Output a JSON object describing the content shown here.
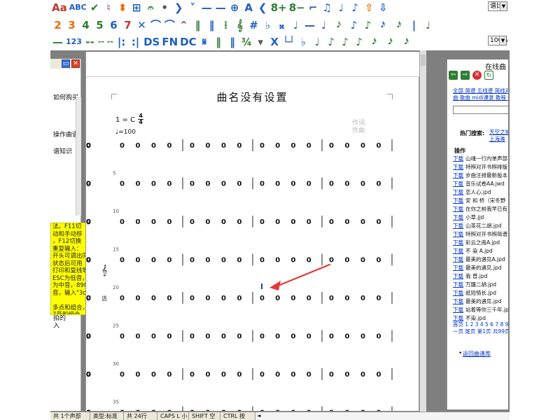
{
  "toolbar": {
    "row1": [
      "Aa",
      "ABC",
      "✔",
      "♮",
      "⬍",
      "⊞",
      "𝄐",
      "•",
      "❯",
      "˅",
      "—",
      "—",
      "⊕",
      "A",
      "❮",
      "8+",
      "8−",
      "⌐",
      "♫",
      "♩",
      "♪",
      "⇧",
      "⇩"
    ],
    "row1_combo": "谱比",
    "row2": [
      "2",
      "3",
      "4",
      "5",
      "6",
      "7",
      "✕",
      "⌒",
      "⌒",
      "⌃",
      "‖",
      "‖",
      "⁞",
      "𝄞",
      "#",
      "♭",
      "𝄪",
      "♩",
      "—",
      "♩",
      "𝅘𝅥𝅮",
      "♪",
      "♪",
      "𝅘𝅥𝅯",
      "𝅘𝅥𝅯",
      "|",
      "♩"
    ],
    "row3": [
      "—",
      "123",
      "--",
      "-- --",
      "|:",
      ":|",
      "DS",
      "FN",
      "DC",
      "𝄋",
      "‖",
      "‖",
      "¾",
      "▾",
      "X",
      "└┘",
      "♭",
      "♩",
      "♪",
      "♪",
      "♪",
      "𝅘𝅥𝅯",
      "𝅘𝅥𝅯",
      "𝅘𝅥𝅯"
    ],
    "zoom": "100%"
  },
  "left_panel": {
    "line1": "如何购买",
    "line2": "操作曲谱",
    "line3": "谱知识",
    "note_lines": [
      "法。F11切",
      "动和手动移",
      "，F12切换",
      "重复输入：",
      "开头可调出同",
      "状态后可用",
      "打印和复线等",
      "ESC为低音，",
      "为中音，890",
      "音，输入\"3o，]",
      "",
      "多点和组合，",
      "7音和组合，",
      "1.5拍组合。"
    ],
    "bottom_lines": [
      "拍的",
      "入"
    ]
  },
  "score": {
    "title": "曲名没有设置",
    "key": "1 = C",
    "time_num": "4",
    "time_den": "4",
    "tempo": "♩=100",
    "lyricist": "作词:",
    "composer": "作曲:",
    "clef_side": "𝄞",
    "row_side_label": "选",
    "rows": [
      {
        "line": "1",
        "measure": "",
        "notes": [
          "0",
          "0",
          "0",
          "0",
          "0",
          "0",
          "0",
          "0",
          "0",
          "0",
          "0",
          "0",
          "0",
          "0",
          "0",
          "0",
          "0",
          "0",
          "0",
          "0"
        ]
      },
      {
        "line": "2",
        "measure": "5",
        "notes": [
          "0",
          "0",
          "0",
          "0",
          "0",
          "0",
          "0",
          "0",
          "0",
          "0",
          "0",
          "0",
          "0",
          "0",
          "0",
          "0",
          "0",
          "0",
          "0",
          "0"
        ]
      },
      {
        "line": "3",
        "measure": "10",
        "notes": [
          "0",
          "0",
          "0",
          "0",
          "0",
          "0",
          "0",
          "0",
          "0",
          "0",
          "0",
          "0",
          "0",
          "0",
          "0",
          "0",
          "0",
          "0",
          "0",
          "0"
        ]
      },
      {
        "line": "4",
        "measure": "15",
        "notes": [
          "0",
          "0",
          "0",
          "0",
          "0",
          "0",
          "0",
          "0",
          "0",
          "0",
          "0",
          "0",
          "0",
          "0",
          "0",
          "0",
          "0",
          "0",
          "0",
          "0"
        ]
      },
      {
        "line": "5",
        "measure": "20",
        "notes": [
          "0",
          "0",
          "0",
          "0",
          "0",
          "0",
          "0",
          "0",
          "0",
          "0",
          "0",
          "0",
          "0",
          "0",
          "0",
          "0",
          "0",
          "0",
          "0",
          "0"
        ]
      },
      {
        "line": "6",
        "measure": "25",
        "notes": [
          "0",
          "0",
          "0",
          "0",
          "0",
          "0",
          "0",
          "0",
          "0",
          "0",
          "0",
          "0",
          "0",
          "0",
          "0",
          "0",
          "0",
          "0",
          "0",
          "0"
        ]
      },
      {
        "line": "7",
        "measure": "30",
        "notes": [
          "0",
          "0",
          "0",
          "0",
          "0",
          "0",
          "0",
          "0",
          "0",
          "0",
          "0",
          "0",
          "0",
          "0",
          "0",
          "0",
          "0",
          "0",
          "0",
          "0"
        ]
      },
      {
        "line": "8",
        "measure": "35",
        "notes": [
          "0",
          "0",
          "0",
          "0",
          "0",
          "0",
          "0",
          "0",
          "0",
          "0",
          "0",
          "0",
          "0",
          "0",
          "0",
          "0",
          "0",
          "0",
          "0",
          "0"
        ]
      }
    ],
    "cursor_row_index": 4,
    "cursor_note_index": 8
  },
  "online_panel": {
    "title": "在线曲",
    "links_line1": "全部 简谱 五线谱 简线对",
    "links_line2": "曲 歌曲 midi课录 教程 传",
    "hot_label": "热门搜索:",
    "hot_link1": "天空之城",
    "hot_link2": "上海滩",
    "ops_header": "操作",
    "download_label": "下载",
    "items": [
      "山魂一行内单声部",
      "特辨对开书辨排版",
      "步曲注排最新版本",
      "音乐试卷AA.jwd",
      "恋人心.jpd",
      "安 和 桥（宋冬野",
      "在你之前我早已有",
      "小草.jjd",
      "山茶花二胡.jpd",
      "特辨对开书辨简谱",
      "彩云之南A.jpd",
      "不 染 A.jpd",
      "最美的遇见A.jpd",
      "最美的遇见.jpd",
      "我 曾.jpd",
      "万疆二胡.jpd",
      "纸短情长.jpd",
      "最美的遇见.jpd",
      "站着等你三千年.jp",
      "不染.jpd"
    ],
    "pages_line1": "首页 1 2 3 4 5 6 7 8 9",
    "pages_line2": "一页 尾页 第1页 共99页",
    "return_link": "返回曲谱库"
  },
  "statusbar": {
    "cells": [
      "共 1个声部",
      "类型:标准",
      "共 24行",
      "CAPS L 小",
      "SHIFT 空",
      "CTRL 按"
    ]
  },
  "colors": {
    "arrow": "#e53935",
    "cursor": "#1f3fbf",
    "link": "#0033cc",
    "note_bg": "#ffff00"
  }
}
